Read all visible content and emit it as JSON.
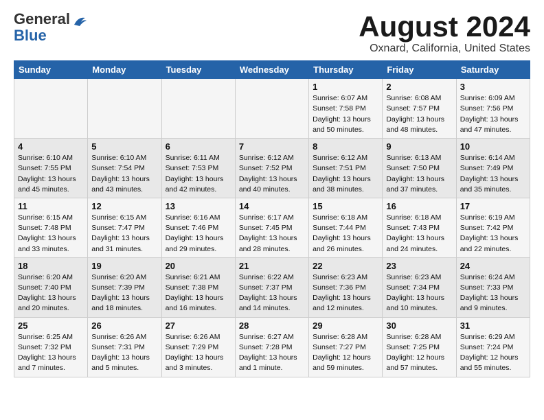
{
  "logo": {
    "text_general": "General",
    "text_blue": "Blue"
  },
  "title": "August 2024",
  "subtitle": "Oxnard, California, United States",
  "headers": [
    "Sunday",
    "Monday",
    "Tuesday",
    "Wednesday",
    "Thursday",
    "Friday",
    "Saturday"
  ],
  "weeks": [
    [
      {
        "day": "",
        "content": ""
      },
      {
        "day": "",
        "content": ""
      },
      {
        "day": "",
        "content": ""
      },
      {
        "day": "",
        "content": ""
      },
      {
        "day": "1",
        "content": "Sunrise: 6:07 AM\nSunset: 7:58 PM\nDaylight: 13 hours\nand 50 minutes."
      },
      {
        "day": "2",
        "content": "Sunrise: 6:08 AM\nSunset: 7:57 PM\nDaylight: 13 hours\nand 48 minutes."
      },
      {
        "day": "3",
        "content": "Sunrise: 6:09 AM\nSunset: 7:56 PM\nDaylight: 13 hours\nand 47 minutes."
      }
    ],
    [
      {
        "day": "4",
        "content": "Sunrise: 6:10 AM\nSunset: 7:55 PM\nDaylight: 13 hours\nand 45 minutes."
      },
      {
        "day": "5",
        "content": "Sunrise: 6:10 AM\nSunset: 7:54 PM\nDaylight: 13 hours\nand 43 minutes."
      },
      {
        "day": "6",
        "content": "Sunrise: 6:11 AM\nSunset: 7:53 PM\nDaylight: 13 hours\nand 42 minutes."
      },
      {
        "day": "7",
        "content": "Sunrise: 6:12 AM\nSunset: 7:52 PM\nDaylight: 13 hours\nand 40 minutes."
      },
      {
        "day": "8",
        "content": "Sunrise: 6:12 AM\nSunset: 7:51 PM\nDaylight: 13 hours\nand 38 minutes."
      },
      {
        "day": "9",
        "content": "Sunrise: 6:13 AM\nSunset: 7:50 PM\nDaylight: 13 hours\nand 37 minutes."
      },
      {
        "day": "10",
        "content": "Sunrise: 6:14 AM\nSunset: 7:49 PM\nDaylight: 13 hours\nand 35 minutes."
      }
    ],
    [
      {
        "day": "11",
        "content": "Sunrise: 6:15 AM\nSunset: 7:48 PM\nDaylight: 13 hours\nand 33 minutes."
      },
      {
        "day": "12",
        "content": "Sunrise: 6:15 AM\nSunset: 7:47 PM\nDaylight: 13 hours\nand 31 minutes."
      },
      {
        "day": "13",
        "content": "Sunrise: 6:16 AM\nSunset: 7:46 PM\nDaylight: 13 hours\nand 29 minutes."
      },
      {
        "day": "14",
        "content": "Sunrise: 6:17 AM\nSunset: 7:45 PM\nDaylight: 13 hours\nand 28 minutes."
      },
      {
        "day": "15",
        "content": "Sunrise: 6:18 AM\nSunset: 7:44 PM\nDaylight: 13 hours\nand 26 minutes."
      },
      {
        "day": "16",
        "content": "Sunrise: 6:18 AM\nSunset: 7:43 PM\nDaylight: 13 hours\nand 24 minutes."
      },
      {
        "day": "17",
        "content": "Sunrise: 6:19 AM\nSunset: 7:42 PM\nDaylight: 13 hours\nand 22 minutes."
      }
    ],
    [
      {
        "day": "18",
        "content": "Sunrise: 6:20 AM\nSunset: 7:40 PM\nDaylight: 13 hours\nand 20 minutes."
      },
      {
        "day": "19",
        "content": "Sunrise: 6:20 AM\nSunset: 7:39 PM\nDaylight: 13 hours\nand 18 minutes."
      },
      {
        "day": "20",
        "content": "Sunrise: 6:21 AM\nSunset: 7:38 PM\nDaylight: 13 hours\nand 16 minutes."
      },
      {
        "day": "21",
        "content": "Sunrise: 6:22 AM\nSunset: 7:37 PM\nDaylight: 13 hours\nand 14 minutes."
      },
      {
        "day": "22",
        "content": "Sunrise: 6:23 AM\nSunset: 7:36 PM\nDaylight: 13 hours\nand 12 minutes."
      },
      {
        "day": "23",
        "content": "Sunrise: 6:23 AM\nSunset: 7:34 PM\nDaylight: 13 hours\nand 10 minutes."
      },
      {
        "day": "24",
        "content": "Sunrise: 6:24 AM\nSunset: 7:33 PM\nDaylight: 13 hours\nand 9 minutes."
      }
    ],
    [
      {
        "day": "25",
        "content": "Sunrise: 6:25 AM\nSunset: 7:32 PM\nDaylight: 13 hours\nand 7 minutes."
      },
      {
        "day": "26",
        "content": "Sunrise: 6:26 AM\nSunset: 7:31 PM\nDaylight: 13 hours\nand 5 minutes."
      },
      {
        "day": "27",
        "content": "Sunrise: 6:26 AM\nSunset: 7:29 PM\nDaylight: 13 hours\nand 3 minutes."
      },
      {
        "day": "28",
        "content": "Sunrise: 6:27 AM\nSunset: 7:28 PM\nDaylight: 13 hours\nand 1 minute."
      },
      {
        "day": "29",
        "content": "Sunrise: 6:28 AM\nSunset: 7:27 PM\nDaylight: 12 hours\nand 59 minutes."
      },
      {
        "day": "30",
        "content": "Sunrise: 6:28 AM\nSunset: 7:25 PM\nDaylight: 12 hours\nand 57 minutes."
      },
      {
        "day": "31",
        "content": "Sunrise: 6:29 AM\nSunset: 7:24 PM\nDaylight: 12 hours\nand 55 minutes."
      }
    ]
  ]
}
